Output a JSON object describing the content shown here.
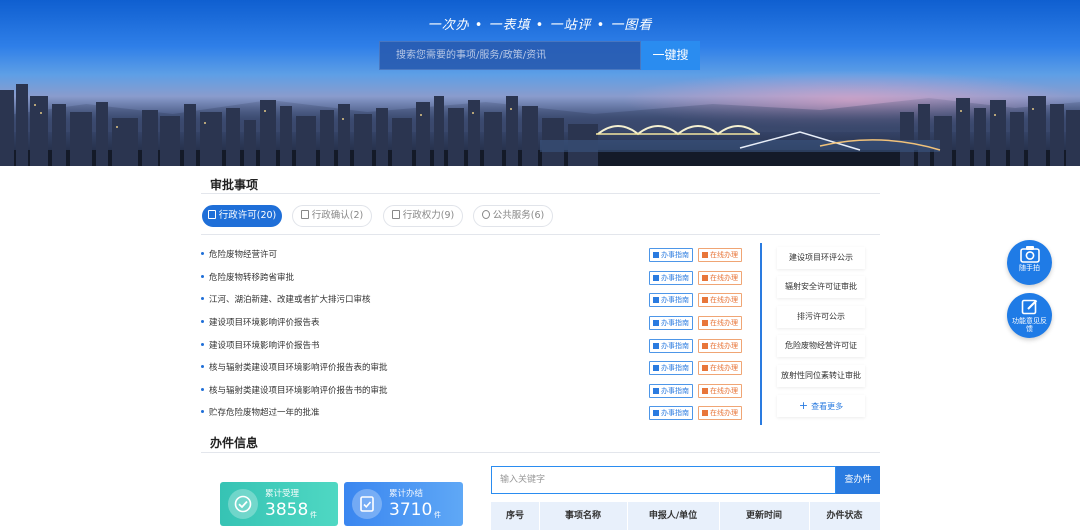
{
  "banner": {
    "slogan": "一次办 • 一表填 • 一站评 • 一图看",
    "search_placeholder": "搜索您需要的事项/服务/政策/资讯",
    "search_button": "一键搜"
  },
  "approvals": {
    "title": "审批事项",
    "tabs": [
      {
        "label": "行政许可(20)",
        "active": true
      },
      {
        "label": "行政确认(2)",
        "active": false
      },
      {
        "label": "行政权力(9)",
        "active": false
      },
      {
        "label": "公共服务(6)",
        "active": false
      }
    ],
    "items": [
      "危险废物经营许可",
      "危险废物转移跨省审批",
      "江河、湖泊新建、改建或者扩大排污口审核",
      "建设项目环境影响评价报告表",
      "建设项目环境影响评价报告书",
      "核与辐射类建设项目环境影响评价报告表的审批",
      "核与辐射类建设项目环境影响评价报告书的审批",
      "贮存危险废物超过一年的批准"
    ],
    "guide_label": "办事指南",
    "online_label": "在线办理"
  },
  "notices": {
    "items": [
      "建设项目环评公示",
      "辐射安全许可证审批",
      "排污许可公示",
      "危险废物经营许可证",
      "放射性同位素转让审批"
    ],
    "more_label": "查看更多"
  },
  "floating": {
    "snapshot_label": "随手拍",
    "feedback_label": "功能意见反馈"
  },
  "case_info": {
    "title": "办件信息",
    "accepted_label": "累计受理",
    "accepted_value": "3858",
    "completed_label": "累计办结",
    "completed_value": "3710",
    "unit": "件",
    "search_placeholder": "输入关键字",
    "search_button": "查办件",
    "columns": [
      "序号",
      "事项名称",
      "申报人/单位",
      "更新时间",
      "办件状态"
    ]
  },
  "colors": {
    "primary": "#1f6fd8",
    "accent_orange": "#e8763a",
    "stat_teal": "#3ecbb9",
    "stat_blue": "#3d8ef2"
  }
}
